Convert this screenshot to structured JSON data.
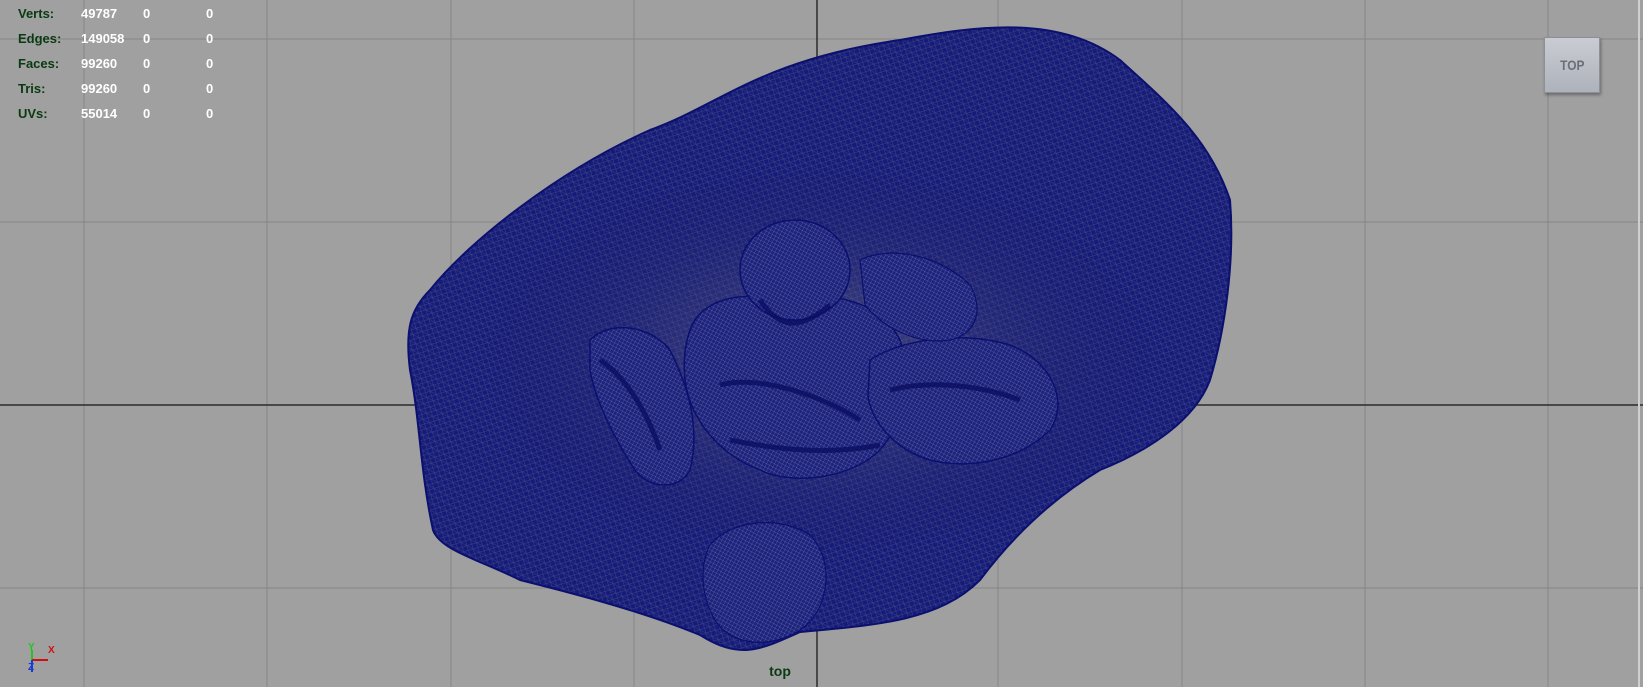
{
  "hud": {
    "rows": [
      {
        "label": "Verts:",
        "values": [
          "49787",
          "0",
          "0"
        ]
      },
      {
        "label": "Edges:",
        "values": [
          "149058",
          "0",
          "0"
        ]
      },
      {
        "label": "Faces:",
        "values": [
          "99260",
          "0",
          "0"
        ]
      },
      {
        "label": "Tris:",
        "values": [
          "99260",
          "0",
          "0"
        ]
      },
      {
        "label": "UVs:",
        "values": [
          "55014",
          "0",
          "0"
        ]
      }
    ]
  },
  "viewcube": {
    "face_label": "TOP"
  },
  "camera": {
    "name": "top"
  },
  "axis_gizmo": {
    "y": "Y",
    "x": "X",
    "z": "Z"
  },
  "colors": {
    "background": "#a0a0a0",
    "grid_line": "#868686",
    "axis_line": "#2a2a2a",
    "mesh_wire": "#0b0f6e",
    "mesh_fill": "#141a78",
    "hud_label": "#0a3a12",
    "hud_value": "#ffffff"
  }
}
